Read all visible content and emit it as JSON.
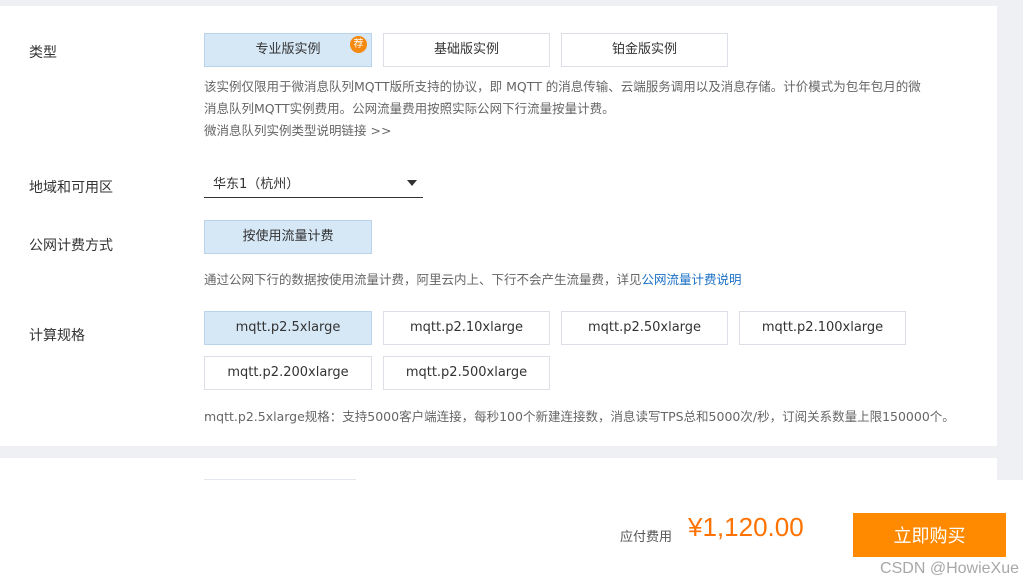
{
  "type_section": {
    "label": "类型",
    "options": [
      {
        "label": "专业版实例",
        "selected": true,
        "badge": "荐"
      },
      {
        "label": "基础版实例",
        "selected": false
      },
      {
        "label": "铂金版实例",
        "selected": false
      }
    ],
    "desc_line1": "该实例仅限用于微消息队列MQTT版所支持的协议，即 MQTT 的消息传输、云端服务调用以及消息存储。计价模式为包年包月的微",
    "desc_line2": "消息队列MQTT实例费用。公网流量费用按照实际公网下行流量按量计费。",
    "desc_link": "微消息队列实例类型说明链接 >>"
  },
  "region_section": {
    "label": "地域和可用区",
    "value": "华东1（杭州）"
  },
  "billing_section": {
    "label": "公网计费方式",
    "option": "按使用流量计费",
    "desc_prefix": "通过公网下行的数据按使用流量计费，阿里云内上、下行不会产生流量费，详见",
    "desc_link": "公网流量计费说明"
  },
  "spec_section": {
    "label": "计算规格",
    "options": [
      {
        "label": "mqtt.p2.5xlarge",
        "selected": true
      },
      {
        "label": "mqtt.p2.10xlarge",
        "selected": false
      },
      {
        "label": "mqtt.p2.50xlarge",
        "selected": false
      },
      {
        "label": "mqtt.p2.100xlarge",
        "selected": false
      },
      {
        "label": "mqtt.p2.200xlarge",
        "selected": false
      },
      {
        "label": "mqtt.p2.500xlarge",
        "selected": false
      }
    ],
    "desc": "mqtt.p2.5xlarge规格：支持5000客户端连接，每秒100个新建连接数，消息读写TPS总和5000次/秒，订阅关系数量上限150000个。"
  },
  "footer": {
    "fee_label": "应付费用",
    "price": "¥1,120.00",
    "buy_label": "立即购买"
  },
  "watermark": "CSDN @HowieXue",
  "colors": {
    "accent_orange": "#ff8a00",
    "selected_bg": "#d6e7f6",
    "link": "#1a6fc4",
    "price": "#ff7200"
  }
}
